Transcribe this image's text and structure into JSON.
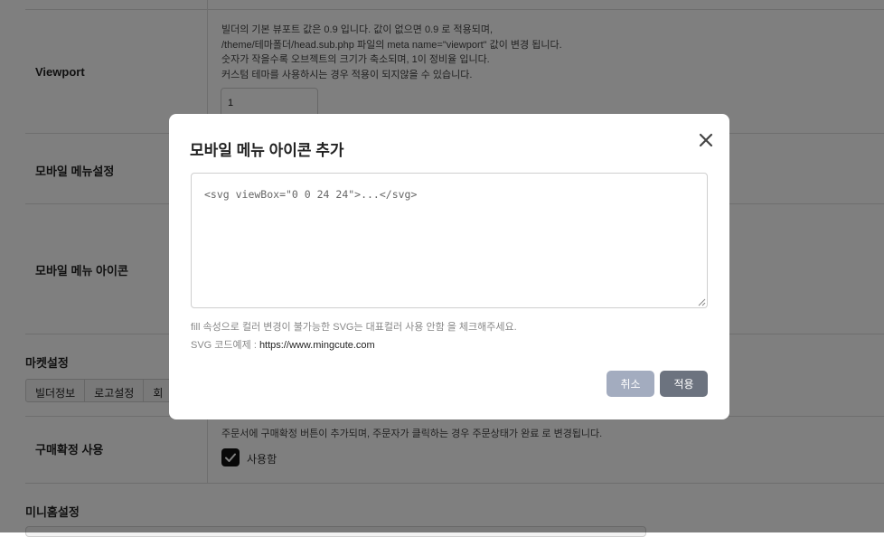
{
  "background": {
    "rows": [
      {
        "label": "Viewport"
      },
      {
        "label": "모바일 메뉴설정"
      },
      {
        "label": "모바일 메뉴 아이콘"
      },
      {
        "label": "구매확정 사용"
      }
    ],
    "viewport": {
      "desc_lines": [
        "빌더의 기본 뷰포트 값은 0.9 입니다. 값이 없으면 0.9 로 적용되며,",
        "/theme/테마폴더/head.sub.php 파일의 meta name=\"viewport\" 값이 변경 됩니다.",
        "숫자가 작을수록 오브젝트의 크기가 축소되며, 1이 정비율 입니다.",
        "커스텀 테마를 사용하시는 경우 적용이 되지않을 수 있습니다."
      ],
      "value": "1"
    },
    "market_section_title": "마켓설정",
    "market_tabs": [
      "빌더정보",
      "로고설정",
      "회"
    ],
    "purchase_confirm": {
      "desc": "주문서에 구매확정 버튼이 추가되며, 주문자가 클릭하는 경우 주문상태가 완료 로 변경됩니다.",
      "checkbox_label": "사용함",
      "checked": true
    },
    "minihome_section_title": "미니홈설정"
  },
  "modal": {
    "title": "모바일 메뉴 아이콘 추가",
    "textarea_value": "<svg viewBox=\"0 0 24 24\">...</svg>",
    "hint_line1": "fill 속성으로 컬러 변경이 불가능한 SVG는 대표컬러 사용 안함 을 체크해주세요.",
    "hint_line2_prefix": "SVG 코드예제 : ",
    "hint_line2_link": "https://www.mingcute.com",
    "cancel_label": "취소",
    "apply_label": "적용"
  },
  "colors": {
    "overlay": "rgba(0,0,0,0.5)",
    "cancel_button": "#a3acbf",
    "apply_button": "#6c737f"
  }
}
